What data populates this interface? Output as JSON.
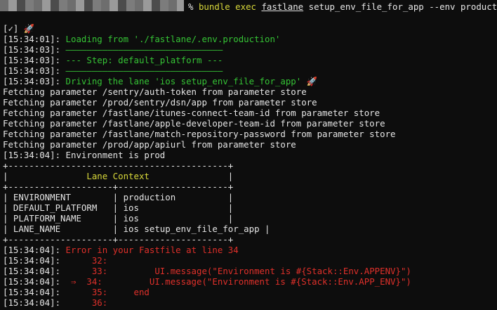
{
  "prompt": {
    "symbol": "%",
    "cmd1": "bundle exec",
    "cmd2": "fastlane",
    "cmd3": "setup_env_file_for_app --env production"
  },
  "lines": {
    "check": "[✓]",
    "rocket": "🚀",
    "l1_ts": "[15:34:01]:",
    "l1_text": "Loading from './fastlane/.env.production'",
    "l2_ts": "[15:34:03]:",
    "l2_text": "——————————————————————————————",
    "l3_ts": "[15:34:03]:",
    "l3_text": "--- Step: default_platform ---",
    "l4_ts": "[15:34:03]:",
    "l4_text": "——————————————————————————————",
    "l5_ts": "[15:34:03]:",
    "l5_text": "Driving the lane 'ios setup_env_file_for_app' 🚀",
    "fetch": [
      "Fetching parameter /sentry/auth-token from parameter store",
      "Fetching parameter /prod/sentry/dsn/app from parameter store",
      "Fetching parameter /fastlane/itunes-connect-team-id from parameter store",
      "Fetching parameter /fastlane/apple-developer-team-id from parameter store",
      "Fetching parameter /fastlane/match-repository-password from parameter store",
      "Fetching parameter /prod/app/apiurl from parameter store"
    ],
    "env_ts": "[15:34:04]:",
    "env_text": "Environment is prod"
  },
  "table": {
    "top": "+------------------------------------------+",
    "title_pre": "|               ",
    "title": "Lane Context",
    "title_post": "               |",
    "sep": "+--------------------+---------------------+",
    "rows": [
      "| ENVIRONMENT        | production          |",
      "| DEFAULT_PLATFORM   | ios                 |",
      "| PLATFORM_NAME      | ios                 |",
      "| LANE_NAME          | ios setup_env_file_for_app |"
    ],
    "bottom": "+--------------------+---------------------+"
  },
  "error": {
    "ts": [
      "[15:34:04]:",
      "[15:34:04]:",
      "[15:34:04]:",
      "[15:34:04]:",
      "[15:34:04]:",
      "[15:34:04]:"
    ],
    "msg": "Error in your Fastfile at line 34",
    "l32": "      32:",
    "l33": "      33:         UI.message(\"Environment is #{Stack::Env.APPENV}\")",
    "l34": "  ⇒  34:         UI.message(\"Environment is #{Stack::Env.APP_ENV}\")",
    "l35": "      35:     end",
    "l36": "      36:"
  }
}
